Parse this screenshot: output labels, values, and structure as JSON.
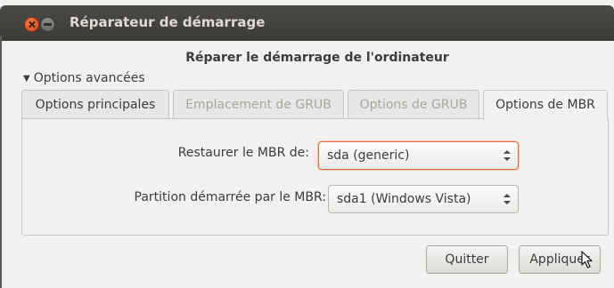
{
  "window": {
    "title": "Réparateur de démarrage"
  },
  "heading": "Réparer le démarrage de l'ordinateur",
  "expander": {
    "label": "Options avancées",
    "arrow": "▼",
    "expanded": true
  },
  "tabs": [
    {
      "label": "Options principales",
      "state": "enabled"
    },
    {
      "label": "Emplacement de GRUB",
      "state": "disabled"
    },
    {
      "label": "Options de GRUB",
      "state": "disabled"
    },
    {
      "label": "Options de MBR",
      "state": "active"
    }
  ],
  "mbr": {
    "restore_label": "Restaurer le MBR de:",
    "restore_value": "sda (generic)",
    "partition_label": "Partition démarrée par le MBR:",
    "partition_value": "sda1 (Windows Vista)"
  },
  "buttons": {
    "quit": "Quitter",
    "apply": "Appliquer"
  },
  "colors": {
    "titlebar": "#3c3b37",
    "title_text": "#dfdbd2",
    "close_button": "#e05a2b",
    "focus_border": "#e0703f",
    "window_bg": "#f2f1f0"
  },
  "icons": {
    "close": "close-icon",
    "minimize": "minimize-icon",
    "expander": "triangle-down-icon",
    "combo_arrows": "updown-arrows-icon",
    "cursor": "mouse-pointer-icon"
  }
}
